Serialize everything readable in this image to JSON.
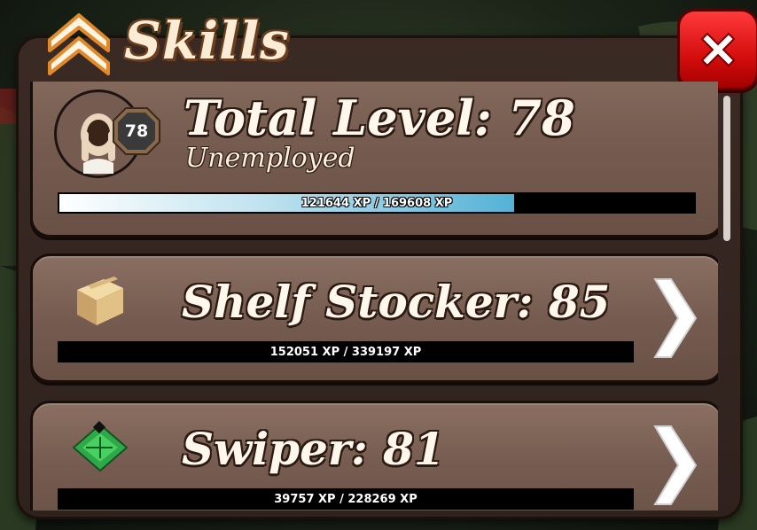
{
  "header": {
    "title": "Skills",
    "close_label": "X"
  },
  "total": {
    "title": "Total Level: 78",
    "occupation": "Unemployed",
    "badge_level": "78",
    "xp_text": "121644 XP / 169608 XP",
    "xp_progress": 0.717
  },
  "skills": [
    {
      "title": "Shelf Stocker: 85",
      "xp_text": "152051 XP / 339197 XP",
      "xp_progress": 0.0,
      "icon": "cardboard-box-icon"
    },
    {
      "title": "Swiper: 81",
      "xp_text": "39757 XP / 228269 XP",
      "xp_progress": 0.0,
      "icon": "circuit-board-icon"
    }
  ],
  "colors": {
    "xp_fill_end": "#54b2d6",
    "close_button": "#e01010",
    "title_text": "#fbecd6"
  }
}
